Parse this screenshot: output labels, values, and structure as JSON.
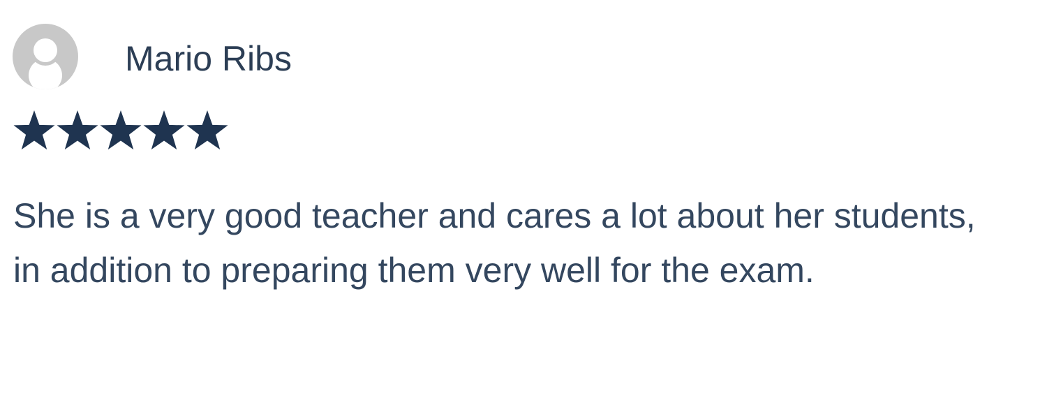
{
  "review": {
    "author": "Mario Ribs",
    "avatar_icon": "default-user-avatar-icon",
    "rating": 5,
    "rating_max": 5,
    "star_icon": "star-icon",
    "text": "She is a very good teacher and cares a lot about her students, in addition to preparing them very well for the exam."
  },
  "colors": {
    "star": "#1f3450",
    "text": "#34475f",
    "author": "#2c3e55",
    "avatar_bg": "#c8c8c8",
    "avatar_fg": "#ffffff"
  }
}
